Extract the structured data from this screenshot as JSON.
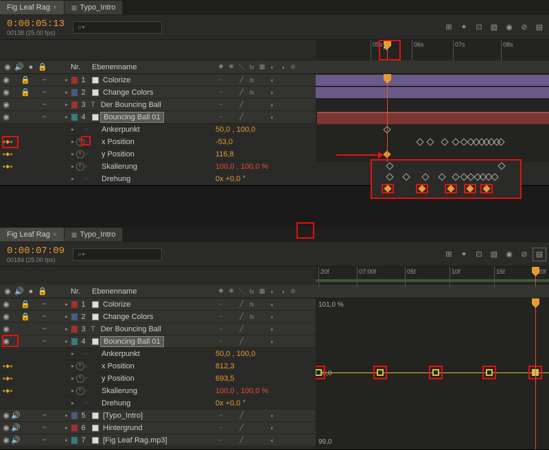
{
  "tabs": {
    "active": "Fig Leaf Rag",
    "other": "Typo_Intro"
  },
  "top": {
    "timecode": "0:00:05:13",
    "frames": "00138 (25.00 fps)",
    "search_placeholder": "⌕▾",
    "header_nr": "Nr.",
    "header_name": "Ebenenname",
    "ruler": [
      "05s",
      "06s",
      "07s",
      "08s"
    ],
    "layers": [
      {
        "n": "1",
        "c": "red",
        "name": "Colorize",
        "fx": true
      },
      {
        "n": "2",
        "c": "blue",
        "name": "Change Colors",
        "fx": true
      },
      {
        "n": "3",
        "c": "red",
        "name": "Der Bouncing Ball",
        "fx": false,
        "text": true
      },
      {
        "n": "4",
        "c": "teal",
        "name": "Bouncing Ball 01",
        "fx": false,
        "sel": true
      }
    ],
    "props": [
      {
        "name": "Ankerpunkt",
        "val": "50,0 , 100,0"
      },
      {
        "name": "x Position",
        "val": "-53,0",
        "kf": true
      },
      {
        "name": "y Position",
        "val": "116,8",
        "kf": true
      },
      {
        "name": "Skalierung",
        "val": "100,0 , 100,0 %",
        "kf": true,
        "red": true
      },
      {
        "name": "Drehung",
        "val": "0x +0,0 °"
      }
    ]
  },
  "bottom": {
    "timecode": "0:00:07:09",
    "frames": "00184 (25.00 fps)",
    "ruler": [
      "20f",
      "07:00f",
      "05f",
      "10f",
      "15f",
      "20f"
    ],
    "graph_top": "101,0 %",
    "graph_mid": "00,0",
    "graph_bot": "99,0",
    "layers": [
      {
        "n": "1",
        "c": "red",
        "name": "Colorize",
        "fx": true
      },
      {
        "n": "2",
        "c": "blue",
        "name": "Change Colors",
        "fx": true
      },
      {
        "n": "3",
        "c": "red",
        "name": "Der Bouncing Ball",
        "fx": false,
        "text": true
      },
      {
        "n": "4",
        "c": "teal",
        "name": "Bouncing Ball 01",
        "fx": false,
        "sel": true
      }
    ],
    "props": [
      {
        "name": "Ankerpunkt",
        "val": "50,0 , 100,0"
      },
      {
        "name": "x Position",
        "val": "812,3",
        "kf": true
      },
      {
        "name": "y Position",
        "val": "693,5",
        "kf": true
      },
      {
        "name": "Skalierung",
        "val": "100,0 , 100,0 %",
        "kf": true,
        "red": true
      },
      {
        "name": "Drehung",
        "val": "0x +0,0 °"
      }
    ],
    "extra_layers": [
      {
        "n": "5",
        "c": "blue",
        "name": "[Typo_Intro]"
      },
      {
        "n": "6",
        "c": "red",
        "name": "Hintergrund"
      },
      {
        "n": "7",
        "c": "teal",
        "name": "[Fig Leaf Rag.mp3]"
      }
    ]
  }
}
